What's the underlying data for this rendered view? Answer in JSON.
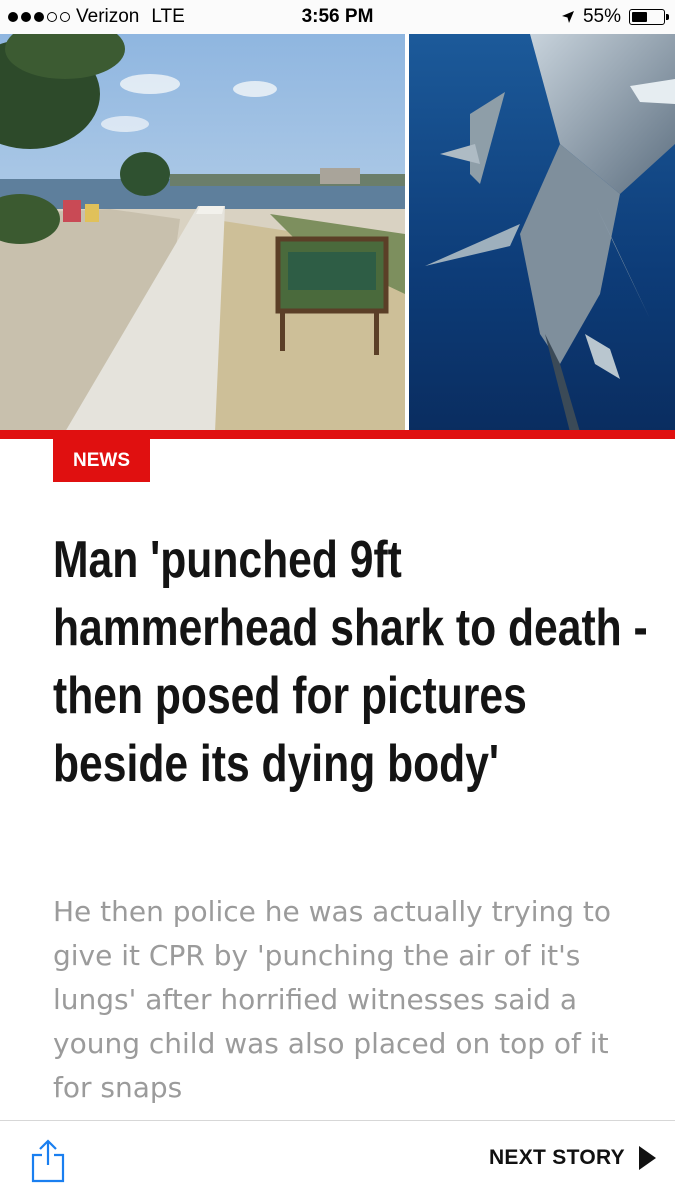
{
  "status_bar": {
    "carrier": "Verizon",
    "network": "LTE",
    "time": "3:56 PM",
    "battery": "55%",
    "battery_level": 0.55,
    "signal_bars_filled": 3,
    "signal_bars_total": 5,
    "icons": [
      "signal-dots-icon",
      "location-arrow-icon",
      "battery-icon"
    ]
  },
  "hero": {
    "left_image": "beach-walkway-photo",
    "right_image": "hammerhead-shark-photo"
  },
  "article": {
    "category": "NEWS",
    "headline": "Man 'punched 9ft hammerhead shark to death - then posed for pictures beside its dying body'",
    "summary": "He then police he was actually trying to give it CPR by 'punching the air of it's lungs' after horrified witnesses said a young child was also placed on top of it for snaps"
  },
  "toolbar": {
    "next_label": "NEXT STORY",
    "share_icon": "share-icon",
    "next_icon": "play-arrow-icon"
  },
  "colors": {
    "accent": "#e01010",
    "headline": "#141414",
    "summary": "#9b9b9b",
    "share_blue": "#1a7ff0"
  }
}
